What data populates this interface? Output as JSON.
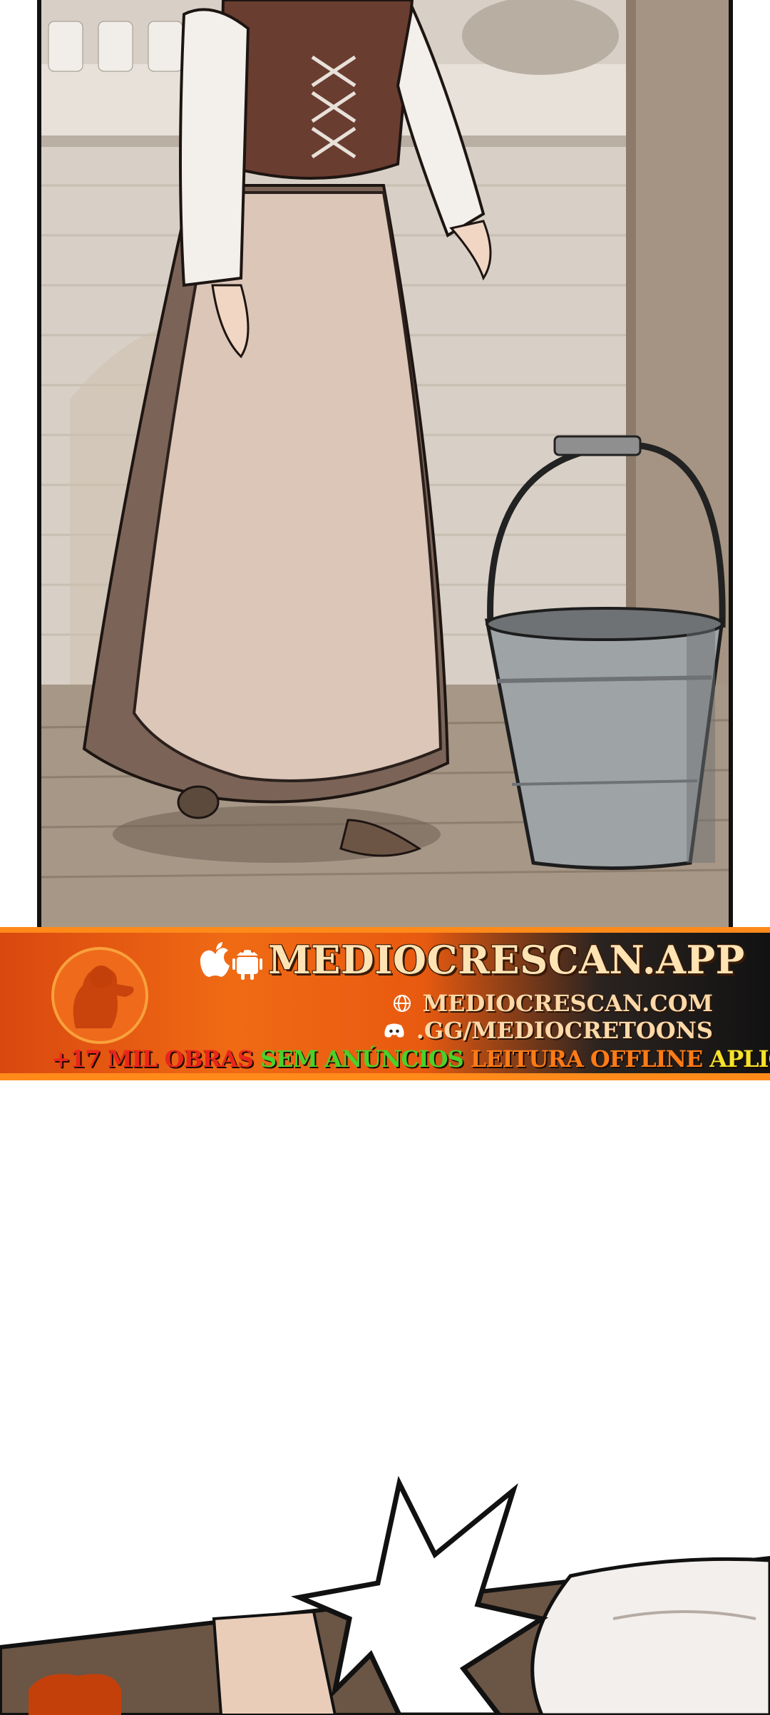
{
  "banner": {
    "site_app": "MEDIOCRESCAN.APP",
    "site_web": "MEDIOCRESCAN.COM",
    "discord": ".GG/MEDIOCRETOONS",
    "features": {
      "works": "+17 MIL OBRAS",
      "no_ads": "SEM ANÚNCIOS",
      "offline": "LEITURA OFFLINE",
      "app": "APLICATIVO"
    },
    "colors": {
      "orange": "#f06a14",
      "dark": "#121212",
      "red": "#e9261b",
      "green": "#4ad12a",
      "yellow": "#f6e32a"
    },
    "icons": [
      "apple-icon",
      "android-icon",
      "globe-icon",
      "discord-icon"
    ]
  }
}
